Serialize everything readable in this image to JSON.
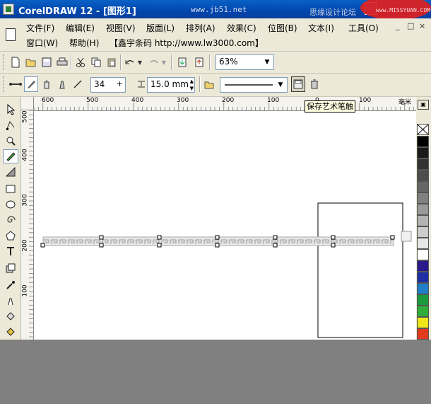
{
  "window": {
    "title": "CorelDRAW 12 - [图形1]",
    "watermark_site": "www.jb51.net",
    "watermark_brand": "思缘设计论坛",
    "watermark_url": "www.MISSYUAN.COM"
  },
  "menu": {
    "row1": [
      {
        "label": "文件(F)"
      },
      {
        "label": "编辑(E)"
      },
      {
        "label": "视图(V)"
      },
      {
        "label": "版面(L)"
      },
      {
        "label": "排列(A)"
      },
      {
        "label": "效果(C)"
      },
      {
        "label": "位图(B)"
      },
      {
        "label": "文本(I)"
      },
      {
        "label": "工具(O)"
      }
    ],
    "row2": [
      {
        "label": "窗口(W)"
      },
      {
        "label": "帮助(H)"
      },
      {
        "label": "【鑫宇条码 http://www.lw3000.com】"
      }
    ],
    "mdi_buttons": [
      "_",
      "□",
      "×"
    ]
  },
  "toolbar_standard": {
    "zoom_value": "63%"
  },
  "toolbar_property": {
    "smoothness_value": "34",
    "width_value": "15.0 mm",
    "save_tooltip": "保存艺术笔触"
  },
  "ruler": {
    "horizontal_labels": [
      "600",
      "500",
      "400",
      "300",
      "200",
      "100",
      "0",
      "100",
      "毫米"
    ],
    "vertical_labels": [
      "500",
      "400",
      "300",
      "200",
      "100"
    ]
  },
  "palette": {
    "colors": [
      "#ffffff",
      "#000000",
      "#1a1a1a",
      "#333333",
      "#4d4d4d",
      "#666666",
      "#808080",
      "#999999",
      "#b3b3b3",
      "#cccccc",
      "#e6e6e6",
      "#ffffff",
      "#2a1a8c",
      "#1e2fa3",
      "#1f7ec8",
      "#1b9a3c",
      "#2fae3a",
      "#f0e71a",
      "#e33b1f",
      "#d07a18"
    ]
  },
  "colors": {
    "titlebar": "#0046ad",
    "toolbar": "#ece9d8",
    "canvas": "#ffffff",
    "desktop": "#808080"
  }
}
